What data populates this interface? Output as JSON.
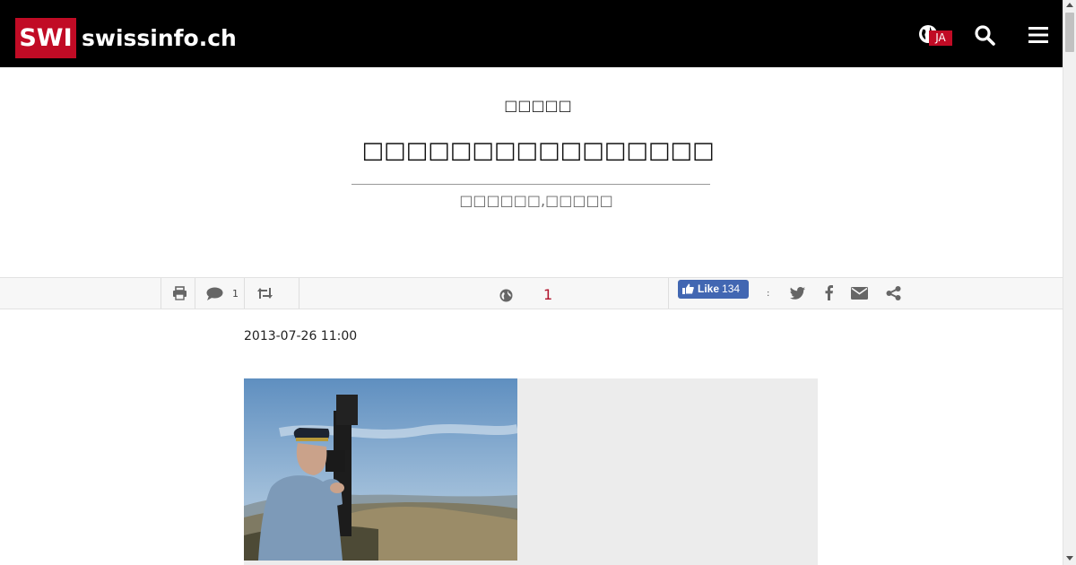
{
  "header": {
    "logo_badge": "SWI",
    "logo_text": "swissinfo.ch",
    "language_code": "JA",
    "brand_color": "#c10b25"
  },
  "article": {
    "kicker": "□□□□□",
    "title": "□□□□□□□□□□□□□□□□",
    "subtitle": "□□□□□□,□□□□□"
  },
  "toolbar": {
    "comment_count": "1",
    "language_versions_count": "1",
    "like_label": "Like",
    "like_count": "134",
    "share_separator": ":"
  },
  "meta": {
    "date": "2013-07-26 11:00"
  },
  "icons": [
    "globe-icon",
    "search-icon",
    "menu-icon",
    "print-icon",
    "comment-icon",
    "republish-icon",
    "twitter-icon",
    "facebook-icon",
    "email-icon",
    "share-icon"
  ]
}
